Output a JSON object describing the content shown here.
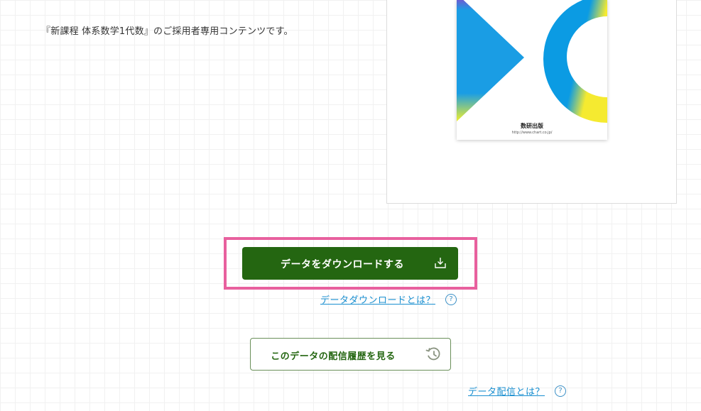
{
  "description": "『新課程 体系数学1代数』のご採用者専用コンテンツです。",
  "cover": {
    "publisher": "数研出版",
    "url": "http://www.chart.co.jp/"
  },
  "download_button": {
    "label": "データをダウンロードする",
    "icon": "download-icon"
  },
  "download_help_link": {
    "label": "データダウンロードとは？",
    "icon": "question-circle-icon",
    "icon_glyph": "?"
  },
  "history_button": {
    "label": "このデータの配信履歴を見る",
    "icon": "history-clock-icon"
  },
  "distribution_help_link": {
    "label": "データ配信とは？",
    "icon": "question-circle-icon",
    "icon_glyph": "?"
  },
  "colors": {
    "primary_green": "#246611",
    "link_blue": "#1a8fd0",
    "highlight_pink": "#e8609e",
    "cover_blue": "#0b9be3"
  }
}
